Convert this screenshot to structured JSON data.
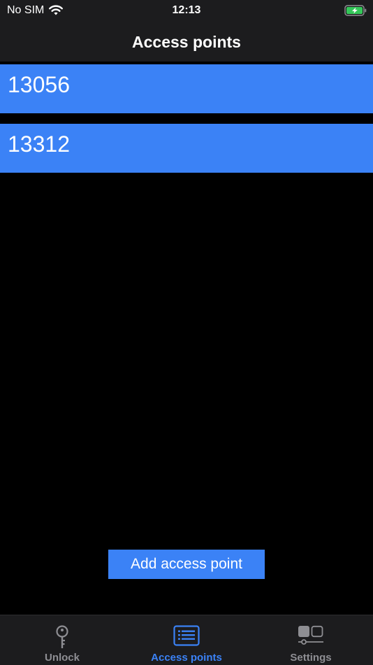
{
  "status_bar": {
    "carrier": "No SIM",
    "time": "12:13",
    "battery_color": "#34c759"
  },
  "nav": {
    "title": "Access points"
  },
  "access_points": [
    {
      "label": "13056"
    },
    {
      "label": "13312"
    }
  ],
  "actions": {
    "add_label": "Add access point"
  },
  "tabs": [
    {
      "label": "Unlock",
      "icon": "key-icon",
      "active": false
    },
    {
      "label": "Access points",
      "icon": "list-icon",
      "active": true
    },
    {
      "label": "Settings",
      "icon": "settings-icon",
      "active": false
    }
  ],
  "colors": {
    "accent": "#3b82f6",
    "inactive": "#8e8e93",
    "bar_background": "#1c1c1e"
  }
}
